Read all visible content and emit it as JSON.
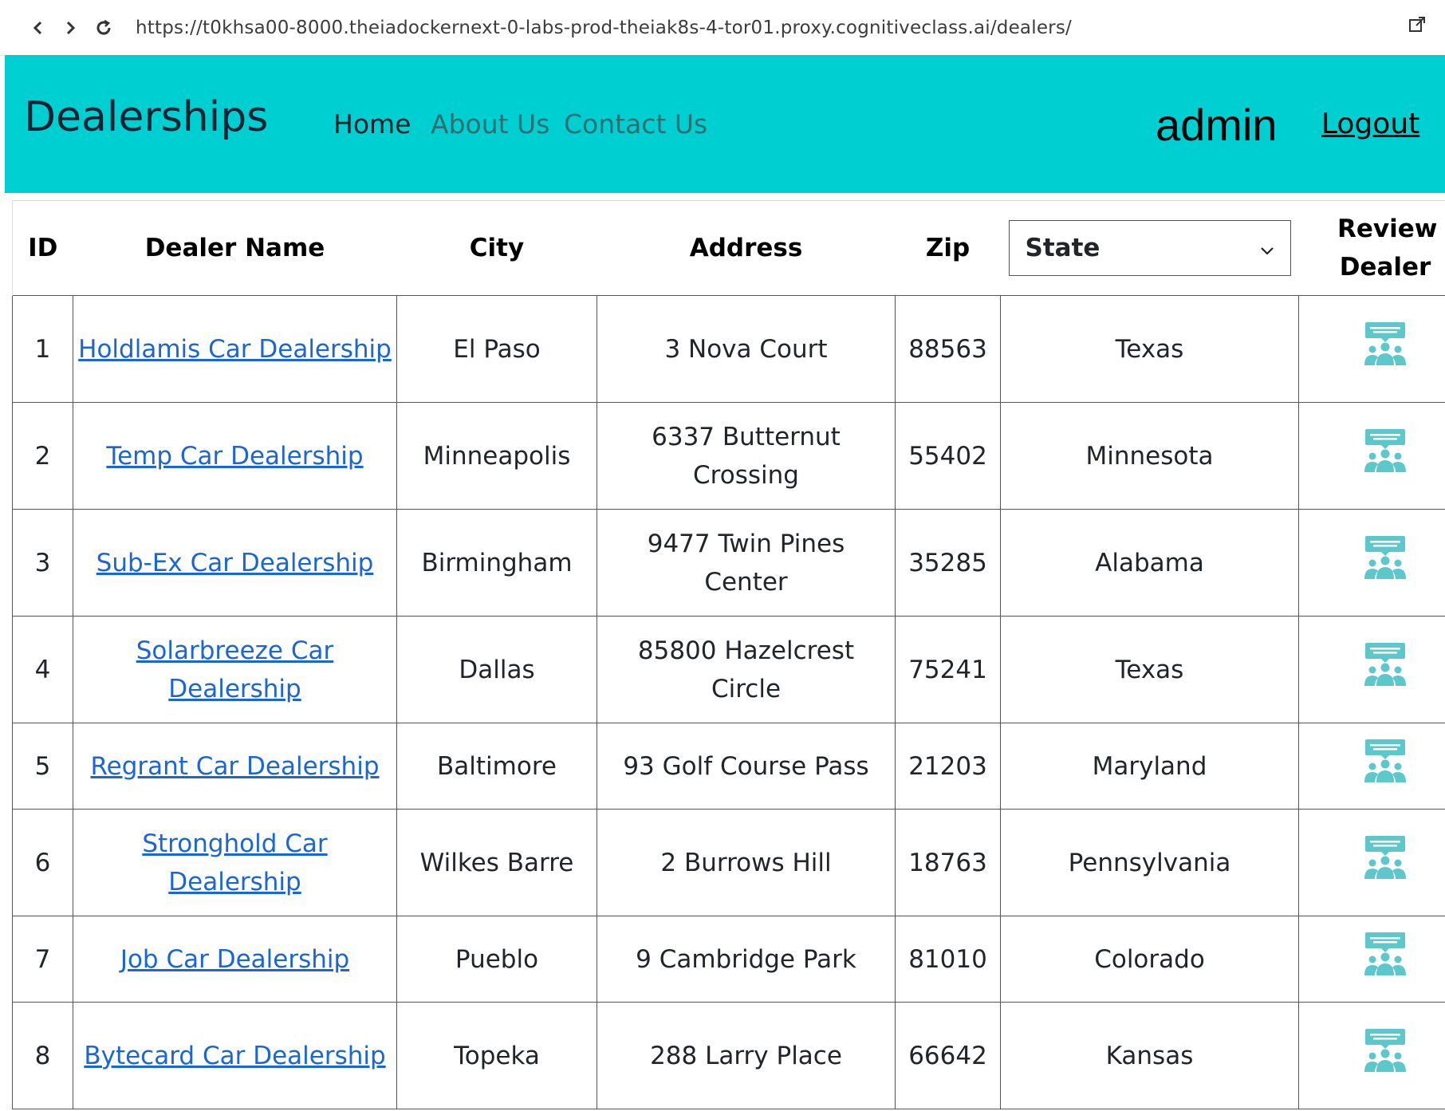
{
  "browser": {
    "url": "https://t0khsa00-8000.theiadockernext-0-labs-prod-theiak8s-4-tor01.proxy.cognitiveclass.ai/dealers/"
  },
  "header": {
    "brand": "Dealerships",
    "nav": {
      "home": "Home",
      "about": "About Us",
      "contact": "Contact Us"
    },
    "user": "admin",
    "logout": "Logout"
  },
  "colors": {
    "header_bg": "#00cfd1",
    "link": "#1a66d6",
    "review_icon": "#5cc8cc"
  },
  "table": {
    "headers": {
      "id": "ID",
      "name": "Dealer Name",
      "city": "City",
      "address": "Address",
      "zip": "Zip",
      "review": "Review Dealer"
    },
    "state_select": {
      "selected": "State",
      "icon": "chevron-down-icon"
    },
    "rows": [
      {
        "id": "1",
        "name": "Holdlamis Car Dealership",
        "city": "El Paso",
        "address": "3 Nova Court",
        "zip": "88563",
        "state": "Texas",
        "icon": "review-dealer-icon"
      },
      {
        "id": "2",
        "name": "Temp Car Dealership",
        "city": "Minneapolis",
        "address": "6337 Butternut Crossing",
        "zip": "55402",
        "state": "Minnesota",
        "icon": "review-dealer-icon"
      },
      {
        "id": "3",
        "name": "Sub-Ex Car Dealership",
        "city": "Birmingham",
        "address": "9477 Twin Pines Center",
        "zip": "35285",
        "state": "Alabama",
        "icon": "review-dealer-icon"
      },
      {
        "id": "4",
        "name": "Solarbreeze Car Dealership",
        "city": "Dallas",
        "address": "85800 Hazelcrest Circle",
        "zip": "75241",
        "state": "Texas",
        "icon": "review-dealer-icon"
      },
      {
        "id": "5",
        "name": "Regrant Car Dealership",
        "city": "Baltimore",
        "address": "93 Golf Course Pass",
        "zip": "21203",
        "state": "Maryland",
        "icon": "review-dealer-icon"
      },
      {
        "id": "6",
        "name": "Stronghold Car Dealership",
        "city": "Wilkes Barre",
        "address": "2 Burrows Hill",
        "zip": "18763",
        "state": "Pennsylvania",
        "icon": "review-dealer-icon"
      },
      {
        "id": "7",
        "name": "Job Car Dealership",
        "city": "Pueblo",
        "address": "9 Cambridge Park",
        "zip": "81010",
        "state": "Colorado",
        "icon": "review-dealer-icon"
      },
      {
        "id": "8",
        "name": "Bytecard Car Dealership",
        "city": "Topeka",
        "address": "288 Larry Place",
        "zip": "66642",
        "state": "Kansas",
        "icon": "review-dealer-icon"
      }
    ]
  }
}
